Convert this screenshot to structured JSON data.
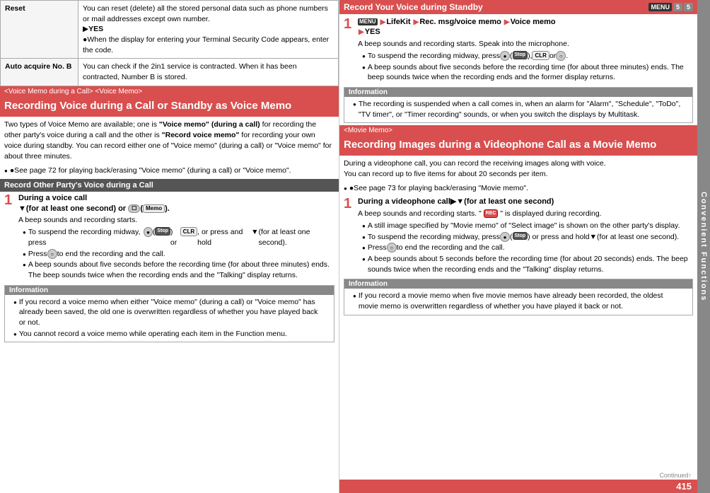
{
  "left": {
    "table": {
      "rows": [
        {
          "header": "Reset",
          "content": "You can reset (delete) all the stored personal data such as phone numbers or mail addresses except own number.\n▶YES\n●When the display for entering your Terminal Security Code appears, enter the code."
        },
        {
          "header": "Auto acquire No. B",
          "content": "You can check if the 2in1 service is contracted. When it has been contracted, Number B is stored."
        }
      ]
    },
    "breadcrumb": "<Voice Memo during a Call> <Voice Memo>",
    "section_title": "Recording Voice during a Call or Standby as Voice Memo",
    "body_text": "Two types of Voice Memo are available; one is \"Voice memo\" (during a call) for recording the other party's voice during a call and the other is \"Record voice memo\" for recording your own voice during standby. You can record either one of \"Voice memo\" (during a call) or \"Voice memo\" for about three minutes.",
    "see_page": "●See page 72 for playing back/erasing \"Voice memo\" (during a call) or \"Voice memo\".",
    "subsection": "Record Other Party's Voice during a Call",
    "step1": {
      "label": "During a voice call",
      "action": "▼(for at least one second) or ☐( Memo ).",
      "desc": "A beep sounds and recording starts.",
      "bullets": [
        "To suspend the recording midway, press ●( Stop ) or CLR, or press and hold ▼(for at least one second).",
        "Press ○ to end the recording and the call.",
        "A beep sounds about five seconds before the recording time (for about three minutes) ends. The beep sounds twice when the recording ends and the \"Talking\" display returns."
      ]
    },
    "info_box": {
      "header": "Information",
      "items": [
        "If you record a voice memo when either \"Voice memo\" (during a call) or \"Voice memo\" has already been saved, the old one is overwritten regardless of whether you have played back or not.",
        "You cannot record a voice memo while operating each item in the Function menu."
      ]
    }
  },
  "right": {
    "standby_title": "Record Your Voice during Standby",
    "menu_numbers": "5 5",
    "step1": {
      "action": "MENU ▶LifeKit▶Rec. msg/voice memo▶Voice memo▶YES",
      "desc": "A beep sounds and recording starts. Speak into the microphone.",
      "bullets": [
        "To suspend the recording midway, press ●( Stop ), CLR or ○.",
        "A beep sounds about five seconds before the recording time (for about three minutes) ends. The beep sounds twice when the recording ends and the former display returns."
      ]
    },
    "info_box1": {
      "header": "Information",
      "items": [
        "The recording is suspended when a call comes in, when an alarm for \"Alarm\", \"Schedule\", \"ToDo\", \"TV timer\", or \"Timer recording\" sounds, or when you switch the displays by Multitask."
      ]
    },
    "breadcrumb2": "<Movie Memo>",
    "section_title2": "Recording Images during a Videophone Call as a Movie Memo",
    "body_text2": "During a videophone call, you can record the receiving images along with voice.\nYou can record up to five items for about 20 seconds per item.",
    "see_page2": "●See page 73 for playing back/erasing \"Movie memo\".",
    "step2": {
      "label": "During a videophone call",
      "action": "▼(for at least one second)",
      "desc": "A beep sounds and recording starts. \" REC \" is displayed during recording.",
      "bullets": [
        "A still image specified by \"Movie memo\" of \"Select image\" is shown on the other party's display.",
        "To suspend the recording midway, press ●( Stop ) or press and hold ▼(for at least one second).",
        "Press ○ to end the recording and the call.",
        "A beep sounds about 5 seconds before the recording time (for about 20 seconds) ends. The beep sounds twice when the recording ends and the \"Talking\" display returns."
      ]
    },
    "info_box2": {
      "header": "Information",
      "items": [
        "If you record a movie memo when five movie memos have already been recorded, the oldest movie memo is overwritten regardless of whether you have played it back or not."
      ]
    },
    "side_label": "Convenient Functions",
    "page_number": "415",
    "continued": "Continued↑"
  }
}
